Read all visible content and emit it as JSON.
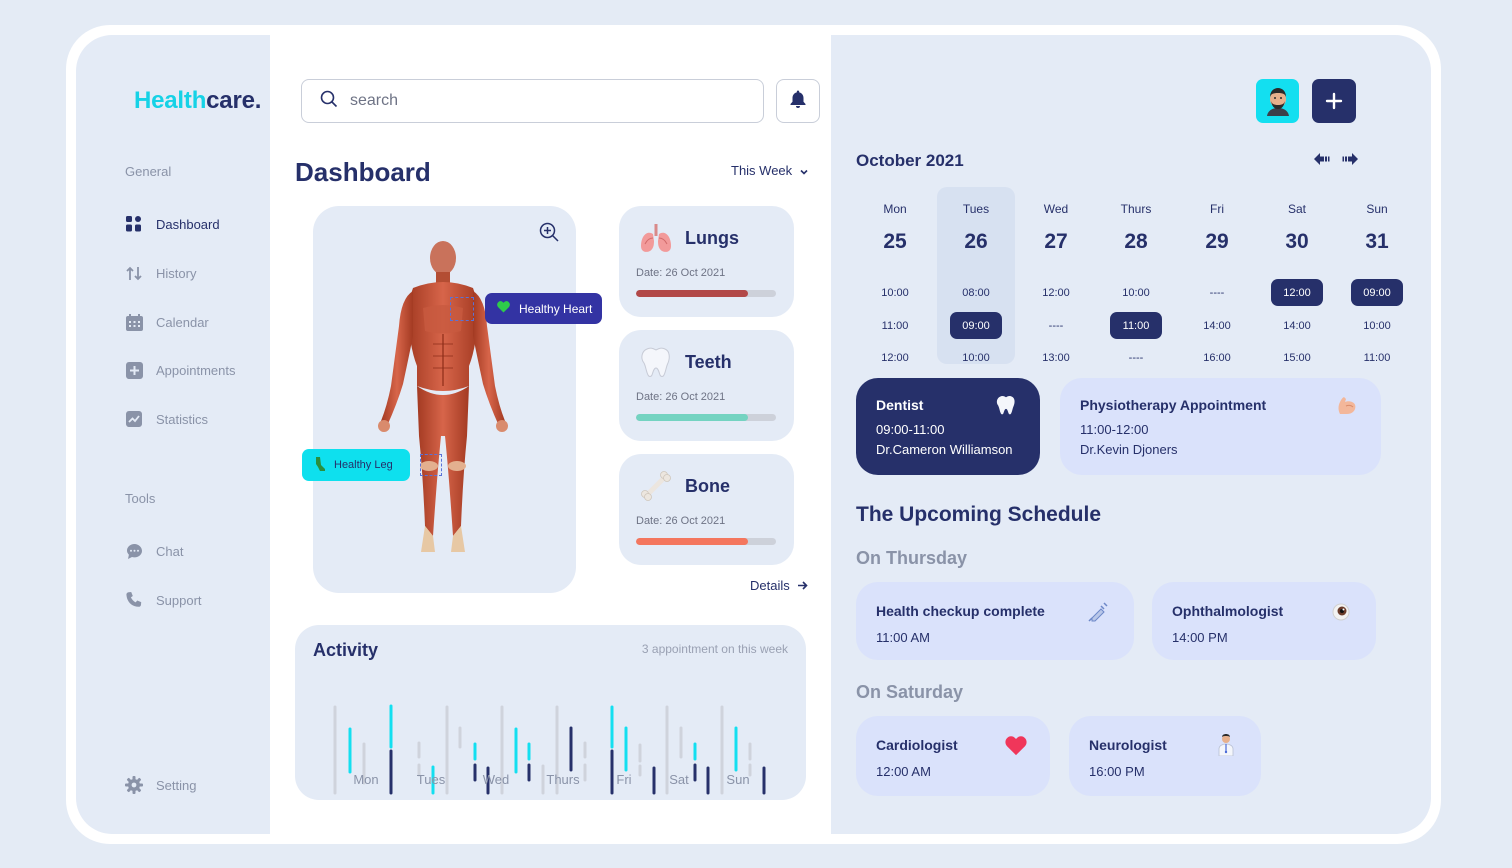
{
  "brand": {
    "name_part1": "Health",
    "name_part2": "care."
  },
  "sidebar": {
    "general_label": "General",
    "tools_label": "Tools",
    "items": [
      {
        "label": "Dashboard",
        "icon": "dashboard-icon",
        "active": true
      },
      {
        "label": "History",
        "icon": "history-icon"
      },
      {
        "label": "Calendar",
        "icon": "calendar-icon"
      },
      {
        "label": "Appointments",
        "icon": "appointments-icon"
      },
      {
        "label": "Statistics",
        "icon": "statistics-icon"
      }
    ],
    "tools": [
      {
        "label": "Chat",
        "icon": "chat-icon"
      },
      {
        "label": "Support",
        "icon": "phone-icon"
      }
    ],
    "setting_label": "Setting"
  },
  "search": {
    "placeholder": "search"
  },
  "dashboard": {
    "title": "Dashboard",
    "period": "This Week",
    "tags": {
      "heart": "Healthy Heart",
      "leg": "Healthy Leg"
    },
    "organs": [
      {
        "name": "Lungs",
        "date": "Date: 26 Oct 2021",
        "progress": 0.8,
        "color": "#b24848",
        "icon": "lungs-icon"
      },
      {
        "name": "Teeth",
        "date": "Date: 26 Oct 2021",
        "progress": 0.8,
        "color": "#74d3c1",
        "icon": "tooth-icon"
      },
      {
        "name": "Bone",
        "date": "Date: 26 Oct 2021",
        "progress": 0.8,
        "color": "#f4765e",
        "icon": "bone-icon"
      }
    ],
    "details_label": "Details"
  },
  "activity": {
    "title": "Activity",
    "subtitle": "3 appointment on this week",
    "days": [
      "Mon",
      "Tues",
      "Wed",
      "Thurs",
      "Fri",
      "Sat",
      "Sun"
    ]
  },
  "calendar": {
    "month": "October 2021",
    "selected_index": 1,
    "days": [
      {
        "day": "Mon",
        "num": "25",
        "slots": [
          "10:00",
          "11:00",
          "12:00"
        ],
        "hl": -1
      },
      {
        "day": "Tues",
        "num": "26",
        "slots": [
          "08:00",
          "09:00",
          "10:00"
        ],
        "hl": 1
      },
      {
        "day": "Wed",
        "num": "27",
        "slots": [
          "12:00",
          "----",
          "13:00"
        ],
        "hl": -1
      },
      {
        "day": "Thurs",
        "num": "28",
        "slots": [
          "10:00",
          "11:00",
          "----"
        ],
        "hl": 1
      },
      {
        "day": "Fri",
        "num": "29",
        "slots": [
          "----",
          "14:00",
          "16:00"
        ],
        "hl": -1
      },
      {
        "day": "Sat",
        "num": "30",
        "slots": [
          "12:00",
          "14:00",
          "15:00"
        ],
        "hl": 0
      },
      {
        "day": "Sun",
        "num": "31",
        "slots": [
          "09:00",
          "10:00",
          "11:00"
        ],
        "hl": 0
      }
    ]
  },
  "appointments": [
    {
      "title": "Dentist",
      "time": "09:00-11:00",
      "doctor": "Dr.Cameron Williamson",
      "icon": "tooth-icon"
    },
    {
      "title": "Physiotherapy Appointment",
      "time": "11:00-12:00",
      "doctor": "Dr.Kevin Djoners",
      "icon": "muscle-icon"
    }
  ],
  "upcoming": {
    "title": "The Upcoming Schedule",
    "groups": [
      {
        "label": "On Thursday",
        "items": [
          {
            "title": "Health checkup complete",
            "time": "11:00 AM",
            "icon": "syringe-icon"
          },
          {
            "title": "Ophthalmologist",
            "time": "14:00 PM",
            "icon": "eye-icon"
          }
        ]
      },
      {
        "label": "On Saturday",
        "items": [
          {
            "title": "Cardiologist",
            "time": "12:00 AM",
            "icon": "heart-icon"
          },
          {
            "title": "Neurologist",
            "time": "16:00 PM",
            "icon": "doctor-icon"
          }
        ]
      }
    ]
  },
  "colors": {
    "navy": "#26306a",
    "cyan": "#13dff0",
    "panel": "#e4ebf6",
    "page_bg": "#e4ebf5"
  }
}
